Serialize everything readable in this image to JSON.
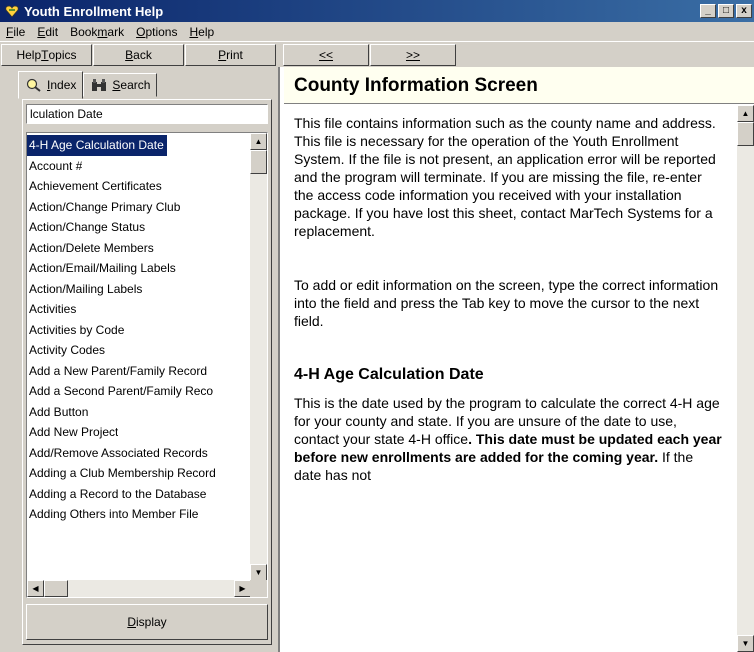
{
  "window": {
    "title": "Youth Enrollment Help",
    "controls": [
      "_",
      "□",
      "x"
    ]
  },
  "menu": [
    {
      "label": "File",
      "key": "F",
      "rest": "ile"
    },
    {
      "label": "Edit",
      "key": "E",
      "rest": "dit"
    },
    {
      "label": "Bookmark",
      "pre": "Book",
      "key": "m",
      "rest": "ark"
    },
    {
      "label": "Options",
      "key": "O",
      "rest": "ptions"
    },
    {
      "label": "Help",
      "key": "H",
      "rest": "elp"
    }
  ],
  "toolbar": {
    "help_topics_pre": "Help ",
    "help_topics_key": "T",
    "help_topics_rest": "opics",
    "back_key": "B",
    "back_rest": "ack",
    "print_key": "P",
    "print_rest": "rint",
    "prev_label": "<<",
    "next_label": ">>"
  },
  "tabs": {
    "index_key": "I",
    "index_rest": "ndex",
    "search_key": "S",
    "search_rest": "earch"
  },
  "index": {
    "input_value": "lculation Date",
    "items": [
      "4-H Age Calculation Date",
      "Account #",
      "Achievement Certificates",
      "Action/Change Primary Club",
      "Action/Change Status",
      "Action/Delete Members",
      "Action/Email/Mailing Labels",
      "Action/Mailing Labels",
      "Activities",
      "Activities by Code",
      "Activity Codes",
      "Add a New Parent/Family Record",
      "Add a Second Parent/Family Reco",
      "Add Button",
      "Add New Project",
      "Add/Remove Associated Records",
      "Adding a Club Membership Record",
      "Adding a Record to the Database",
      "Adding Others into Member File"
    ],
    "selected_index": 0,
    "display_key": "D",
    "display_rest": "isplay"
  },
  "topic": {
    "title": "County Information Screen",
    "para1": "This file contains information such as the county name and address.  This file is necessary for the operation of the Youth Enrollment System.  If the file is not present, an application error will be reported and the program will terminate.  If you are missing the file, re-enter the access code information you received with your installation package.  If you have lost this sheet, contact MarTech Systems for a replacement.",
    "para2": "To add or edit information on the screen, type the correct information into the field and press the Tab key to move the cursor to the next field.",
    "subheading": "4-H Age Calculation Date",
    "para3_a": "This is the date used by the program to calculate the correct 4-H age for your county and state. If you are unsure of the date to use, contact your state 4-H office",
    "para3_b": ". This date must be updated each year before new enrollments are added for the coming year.",
    "para3_c": " If the date has not"
  }
}
